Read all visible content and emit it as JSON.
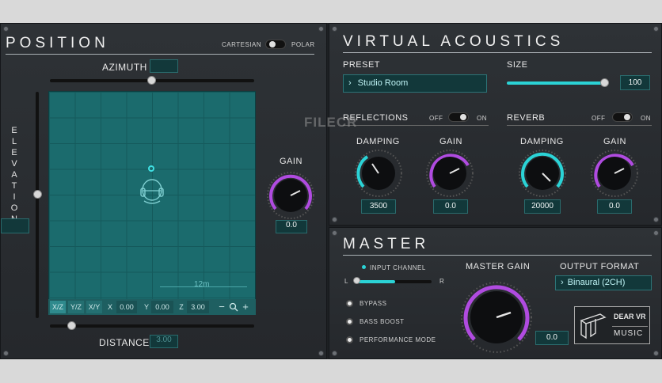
{
  "position": {
    "title": "POSITION",
    "mode_left": "CARTESIAN",
    "mode_right": "POLAR",
    "azimuth_label": "AZIMUTH",
    "elevation_label": "ELEVATION",
    "distance_label": "DISTANCE",
    "distance_value": "3.00",
    "gain_label": "GAIN",
    "gain_value": "0.0",
    "scale_label": "12m",
    "plane_buttons": [
      "X/Z",
      "Y/Z",
      "X/Y"
    ],
    "x_label": "X",
    "x_value": "0.00",
    "y_label": "Y",
    "y_value": "0.00",
    "z_label": "Z",
    "z_value": "3.00",
    "zoom_minus": "−",
    "zoom_icon": "magnifier-icon",
    "zoom_plus": "+"
  },
  "acoustics": {
    "title": "VIRTUAL ACOUSTICS",
    "preset_label": "PRESET",
    "preset_value": "Studio Room",
    "size_label": "SIZE",
    "size_value": "100",
    "size_fraction": 0.96,
    "reflections_label": "REFLECTIONS",
    "reverb_label": "REVERB",
    "off": "OFF",
    "on": "ON",
    "refl_damping_label": "DAMPING",
    "refl_damping_value": "3500",
    "refl_gain_label": "GAIN",
    "refl_gain_value": "0.0",
    "rev_damping_label": "DAMPING",
    "rev_damping_value": "20000",
    "rev_gain_label": "GAIN",
    "rev_gain_value": "0.0"
  },
  "watermark": "FILECR",
  "master": {
    "title": "MASTER",
    "input_channel_label": "INPUT CHANNEL",
    "left": "L",
    "right": "R",
    "master_gain_label": "MASTER GAIN",
    "master_gain_value": "0.0",
    "output_format_label": "OUTPUT FORMAT",
    "output_format_value": "Binaural (2CH)",
    "options": [
      "BYPASS",
      "BASS BOOST",
      "PERFORMANCE MODE"
    ],
    "logo_top": "DEAR VR",
    "logo_bottom": "MUSIC"
  },
  "colors": {
    "accent": "#2bd3d6",
    "knob_arc": "#b04be0",
    "grid": "#1b6b6d"
  }
}
